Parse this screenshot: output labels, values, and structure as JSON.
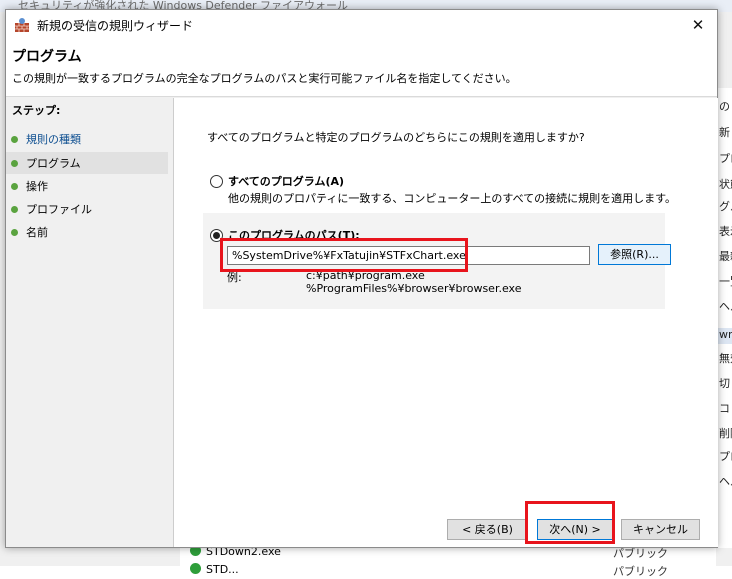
{
  "background": {
    "title_text": "セキュリティが強化された Windows Defender ファイアウォール",
    "right_items": [
      "の",
      "新し",
      "プロ",
      "状態",
      "グル",
      "表示",
      "最新",
      "一覧",
      "ヘル",
      "wn",
      "無効",
      "切り",
      "コピ",
      "削除",
      "プロ",
      "ヘル"
    ],
    "rows": [
      {
        "name": "STDown2.exe",
        "profile": "パブリック"
      },
      {
        "name": "STD...",
        "profile": "パブリック"
      }
    ]
  },
  "dialog": {
    "title": "新規の受信の規則ウィザード",
    "close_glyph": "✕",
    "header": {
      "title": "プログラム",
      "description": "この規則が一致するプログラムの完全なプログラムのパスと実行可能ファイル名を指定してください。"
    },
    "steps": {
      "label": "ステップ:",
      "items": [
        {
          "label": "規則の種類",
          "state": "done"
        },
        {
          "label": "プログラム",
          "state": "current"
        },
        {
          "label": "操作",
          "state": "pending"
        },
        {
          "label": "プロファイル",
          "state": "pending"
        },
        {
          "label": "名前",
          "state": "pending"
        }
      ]
    },
    "content": {
      "question": "すべてのプログラムと特定のプログラムのどちらにこの規則を適用しますか?",
      "option_all": {
        "label": "すべてのプログラム(A)",
        "description": "他の規則のプロパティに一致する、コンピューター上のすべての接続に規則を適用します。",
        "checked": false
      },
      "option_path": {
        "label": "このプログラムのパス(T):",
        "checked": true,
        "value": "%SystemDrive%¥FxTatujin¥STFxChart.exe",
        "browse_label": "参照(R)..."
      },
      "example": {
        "label": "例:",
        "lines": [
          "c:¥path¥program.exe",
          "%ProgramFiles%¥browser¥browser.exe"
        ]
      }
    },
    "buttons": {
      "back": "< 戻る(B)",
      "next": "次へ(N) >",
      "cancel": "キャンセル"
    },
    "colors": {
      "highlight": "#e8141c",
      "step_dot": "#5aa33f",
      "link_blue": "#0e4f91"
    }
  }
}
